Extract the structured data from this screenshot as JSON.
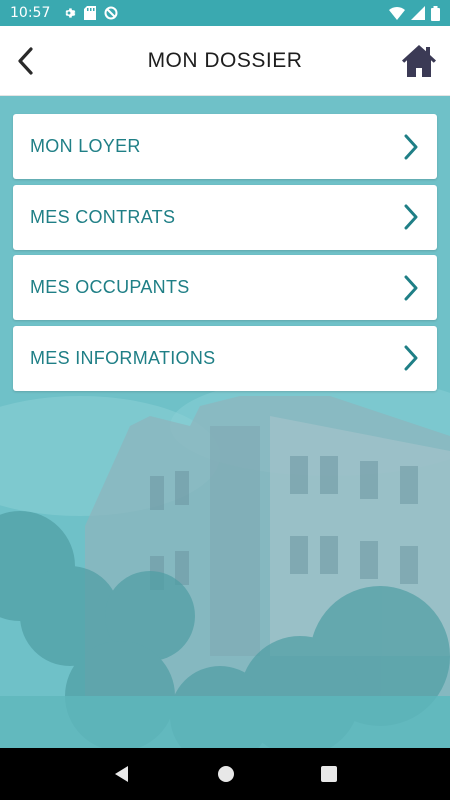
{
  "status_bar": {
    "time": "10:57",
    "icons": [
      "gear-icon",
      "sd-card-icon",
      "no-sync-icon"
    ],
    "right_icons": [
      "wifi-icon",
      "signal-icon",
      "battery-icon"
    ]
  },
  "header": {
    "title": "MON DOSSIER",
    "back_icon": "chevron-left-icon",
    "home_icon": "home-icon"
  },
  "menu": {
    "items": [
      {
        "label": "MON LOYER"
      },
      {
        "label": "MES CONTRATS"
      },
      {
        "label": "MES OCCUPANTS"
      },
      {
        "label": "MES INFORMATIONS"
      }
    ]
  },
  "nav_bar": {
    "buttons": [
      "back-triangle-icon",
      "home-circle-icon",
      "recents-square-icon"
    ]
  },
  "colors": {
    "status_bar": "#3aa9b0",
    "accent_text": "#1f7f86",
    "home_icon": "#3b3a55",
    "background_tint": "#6cbfc7"
  }
}
